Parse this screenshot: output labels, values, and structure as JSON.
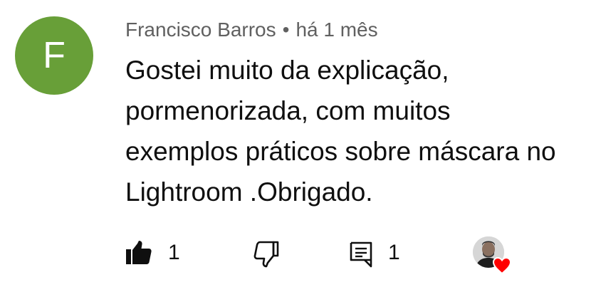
{
  "comment": {
    "avatar_letter": "F",
    "avatar_color": "#689f38",
    "author": "Francisco Barros",
    "separator": "•",
    "time": "há 1 mês",
    "text_lines": [
      "Gostei muito da explicação,",
      "pormenorizada, com muitos",
      "exemplos práticos sobre máscara no",
      "Lightroom .Obrigado."
    ]
  },
  "actions": {
    "like_icon": "thumbs-up-filled-icon",
    "like_count": "1",
    "dislike_icon": "thumbs-down-outline-icon",
    "reply_icon": "comment-reply-icon",
    "reply_count": "1",
    "creator_heart_icon": "heart-icon",
    "heart_color": "#ff0000"
  }
}
